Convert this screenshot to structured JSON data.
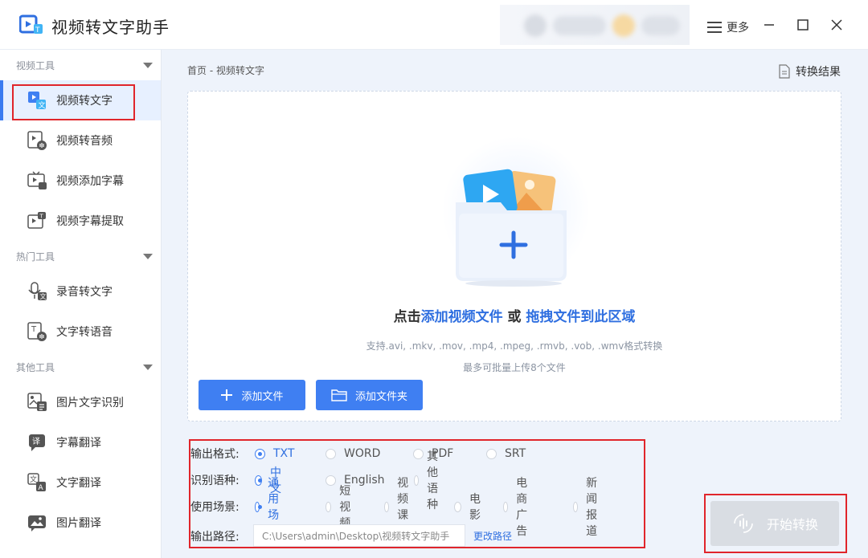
{
  "app": {
    "title": "视频转文字助手"
  },
  "header": {
    "more_label": "更多"
  },
  "sidebar": {
    "sections": [
      {
        "label": "视频工具",
        "items": [
          {
            "label": "视频转文字",
            "icon": "video-to-text-icon"
          },
          {
            "label": "视频转音频",
            "icon": "video-to-audio-icon"
          },
          {
            "label": "视频添加字幕",
            "icon": "add-subtitle-icon"
          },
          {
            "label": "视频字幕提取",
            "icon": "subtitle-extract-icon"
          }
        ]
      },
      {
        "label": "热门工具",
        "items": [
          {
            "label": "录音转文字",
            "icon": "microphone-icon"
          },
          {
            "label": "文字转语音",
            "icon": "text-to-speech-icon"
          }
        ]
      },
      {
        "label": "其他工具",
        "items": [
          {
            "label": "图片文字识别",
            "icon": "image-ocr-icon"
          },
          {
            "label": "字幕翻译",
            "icon": "subtitle-translate-icon"
          },
          {
            "label": "文字翻译",
            "icon": "text-translate-icon"
          },
          {
            "label": "图片翻译",
            "icon": "image-translate-icon"
          }
        ]
      }
    ]
  },
  "main": {
    "breadcrumb": "首页 - 视频转文字",
    "result_label": "转换结果",
    "dropzone": {
      "title_prefix": "点击",
      "title_link1": "添加视频文件",
      "title_mid": " 或 ",
      "title_link2": "拖拽文件到此区域",
      "support": "支持.avi, .mkv, .mov, .mp4, .mpeg, .rmvb, .vob, .wmv格式转换",
      "limit": "最多可批量上传8个文件",
      "add_file": "添加文件",
      "add_folder": "添加文件夹"
    },
    "options": {
      "format": {
        "label": "输出格式:",
        "choices": [
          "TXT",
          "WORD",
          "PDF",
          "SRT"
        ],
        "selected": "TXT"
      },
      "language": {
        "label": "识别语种:",
        "choices": [
          "中文",
          "English",
          "其他语种"
        ],
        "selected": "中文"
      },
      "scene": {
        "label": "使用场景:",
        "choices": [
          "通用场景",
          "短视频",
          "视频课程",
          "电影",
          "电商广告",
          "新闻报道"
        ],
        "selected": "通用场景"
      },
      "path": {
        "label": "输出路径:",
        "value": "C:\\Users\\admin\\Desktop\\视频转文字助手",
        "change_label": "更改路径"
      }
    },
    "start_label": "开始转换"
  },
  "colors": {
    "accent": "#3f7ff2",
    "highlight_red": "#e0252b",
    "disabled": "#d9dde3"
  }
}
